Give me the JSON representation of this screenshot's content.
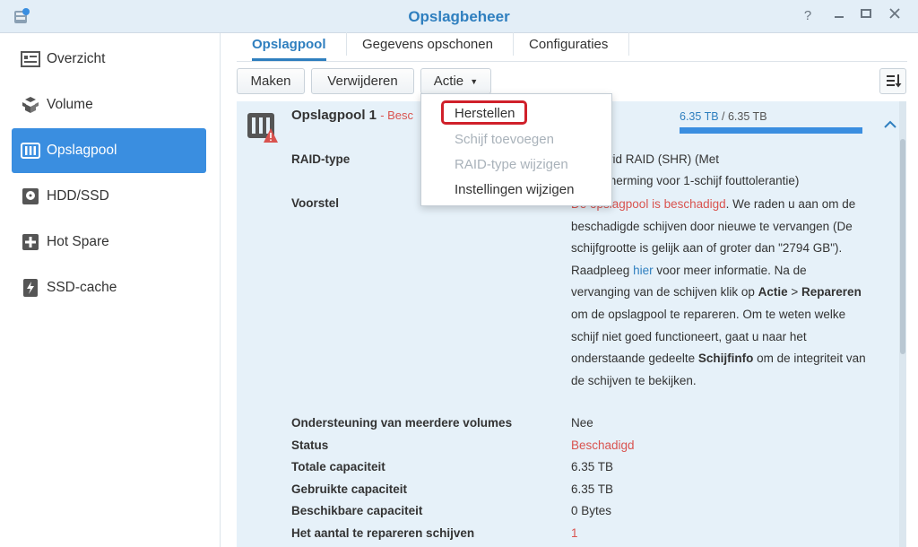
{
  "window": {
    "title": "Opslagbeheer"
  },
  "sidebar": {
    "items": [
      {
        "label": "Overzicht",
        "icon": "overview-icon"
      },
      {
        "label": "Volume",
        "icon": "volume-icon"
      },
      {
        "label": "Opslagpool",
        "icon": "storage-pool-icon",
        "active": true
      },
      {
        "label": "HDD/SSD",
        "icon": "hdd-icon"
      },
      {
        "label": "Hot Spare",
        "icon": "hot-spare-icon"
      },
      {
        "label": "SSD-cache",
        "icon": "ssd-cache-icon"
      }
    ]
  },
  "tabs": [
    {
      "label": "Opslagpool",
      "active": true
    },
    {
      "label": "Gegevens opschonen"
    },
    {
      "label": "Configuraties"
    }
  ],
  "toolbar": {
    "create_label": "Maken",
    "delete_label": "Verwijderen",
    "action_label": "Actie"
  },
  "action_menu": {
    "items": [
      {
        "label": "Herstellen",
        "enabled": true
      },
      {
        "label": "Schijf toevoegen",
        "enabled": false
      },
      {
        "label": "RAID-type wijzigen",
        "enabled": false
      },
      {
        "label": "Instellingen wijzigen",
        "enabled": true
      }
    ]
  },
  "pool": {
    "name": "Opslagpool 1",
    "status_prefix": "- Besc",
    "capacity_used": "6.35 TB",
    "capacity_sep": " / ",
    "capacity_total": "6.35 TB",
    "raid_label": "RAID-type",
    "raid_line1": "gy Hybrid RAID (SHR) (Met",
    "raid_line2": "nsbescherming voor 1-schijf fouttolerantie)",
    "suggestion_label": "Voorstel",
    "suggestion": {
      "red_prefix": "De opslagpool is beschadigd",
      "t1": ". We raden u aan om de beschadigde schijven door nieuwe te vervangen (De schijfgrootte is gelijk aan of groter dan \"2794 GB\"). Raadpleeg ",
      "link": "hier",
      "t2": " voor meer informatie. Na de vervanging van de schijven klik op ",
      "b1": "Actie",
      "t3": " > ",
      "b2": "Repareren",
      "t4": " om de opslagpool te repareren. Om te weten welke schijf niet goed functioneert, gaat u naar het onderstaande gedeelte ",
      "b3": "Schijfinfo",
      "t5": " om de integriteit van de schijven te bekijken."
    },
    "rows": [
      {
        "label": "Ondersteuning van meerdere volumes",
        "value": "Nee"
      },
      {
        "label": "Status",
        "value": "Beschadigd"
      },
      {
        "label": "Totale capaciteit",
        "value": "6.35 TB"
      },
      {
        "label": "Gebruikte capaciteit",
        "value": "6.35 TB"
      },
      {
        "label": "Beschikbare capaciteit",
        "value": "0 Bytes"
      },
      {
        "label": "Het aantal te repareren schijven",
        "value": "1"
      }
    ]
  },
  "colors": {
    "accent": "#2f7fbf",
    "active_bg": "#3a8ee0",
    "error": "#d9534f",
    "highlight": "#d0202a"
  }
}
